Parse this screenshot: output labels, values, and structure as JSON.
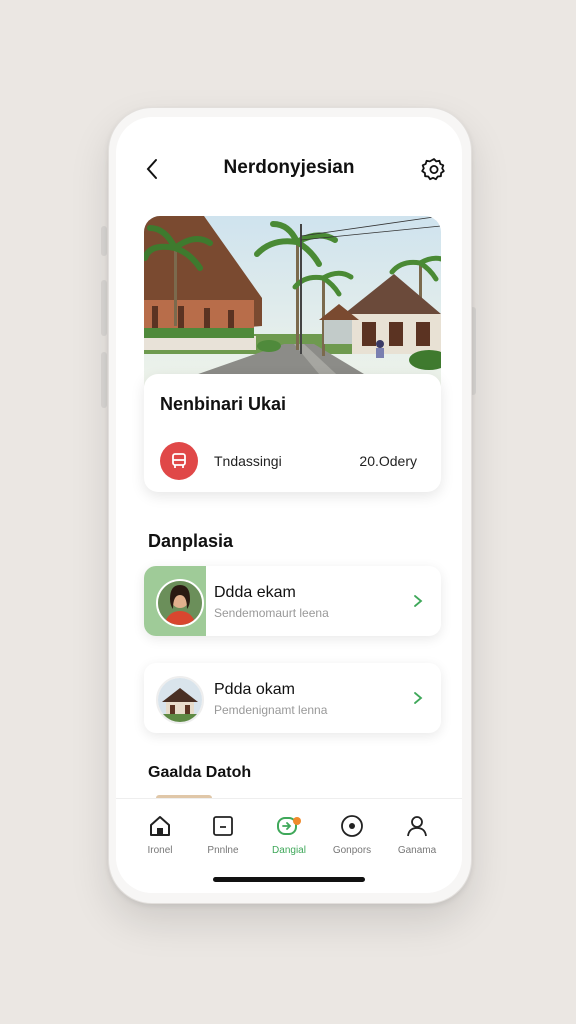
{
  "header": {
    "title": "Nerdonyjesian",
    "back_icon": "chevron-left-icon",
    "settings_icon": "gear-icon"
  },
  "hero": {
    "name": "Nenbinari Ukai",
    "meta": "Tndassingi",
    "distance": "20.Odery",
    "badge_icon": "bus-icon",
    "badge_color": "#e04848"
  },
  "section": {
    "title": "Danplasia"
  },
  "list": [
    {
      "title": "Ddda ekam",
      "subtitle": "Sendemomaurt leena",
      "thumb": "person-avatar"
    },
    {
      "title": "Pdda okam",
      "subtitle": "Pemdenignamt lenna",
      "thumb": "house-avatar"
    }
  ],
  "section2": {
    "title": "Gaalda Datoh"
  },
  "tabs": [
    {
      "label": "Ironel",
      "icon": "home-icon"
    },
    {
      "label": "Pnnlne",
      "icon": "square-icon"
    },
    {
      "label": "Dangial",
      "icon": "chat-icon"
    },
    {
      "label": "Gonpors",
      "icon": "compass-icon"
    },
    {
      "label": "Ganama",
      "icon": "user-icon"
    }
  ],
  "colors": {
    "accent": "#3fa85a",
    "thumb_green": "#9fcb98"
  }
}
